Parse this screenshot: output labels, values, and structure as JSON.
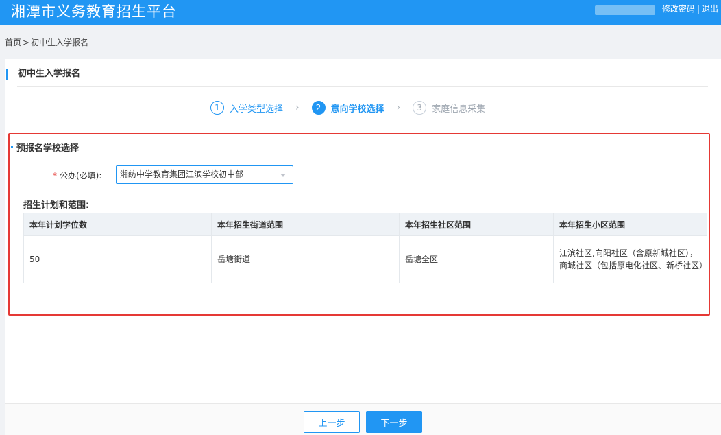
{
  "header": {
    "title": "湘潭市义务教育招生平台",
    "change_password": "修改密码",
    "separator": "|",
    "logout": "退出"
  },
  "breadcrumb": {
    "home": "首页",
    "separator": ">",
    "current": "初中生入学报名"
  },
  "panel": {
    "title": "初中生入学报名"
  },
  "steps": [
    {
      "num": "1",
      "label": "入学类型选择",
      "state": "done"
    },
    {
      "num": "2",
      "label": "意向学校选择",
      "state": "active"
    },
    {
      "num": "3",
      "label": "家庭信息采集",
      "state": "todo"
    }
  ],
  "school_section": {
    "title": "预报名学校选择",
    "required_mark": "*",
    "field_label": "公办(必填):",
    "selected_school": "湘纺中学教育集团江滨学校初中部"
  },
  "plan": {
    "label": "招生计划和范围:",
    "columns": [
      "本年计划学位数",
      "本年招生街道范围",
      "本年招生社区范围",
      "本年招生小区范围"
    ],
    "rows": [
      [
        "50",
        "岳塘街道",
        "岳塘全区",
        "江滨社区,向阳社区（含原新城社区），商城社区（包括原电化社区、新桥社区）"
      ]
    ]
  },
  "buttons": {
    "prev": "上一步",
    "next": "下一步"
  },
  "colors": {
    "brand": "#2196f3",
    "highlight": "#e53935"
  }
}
